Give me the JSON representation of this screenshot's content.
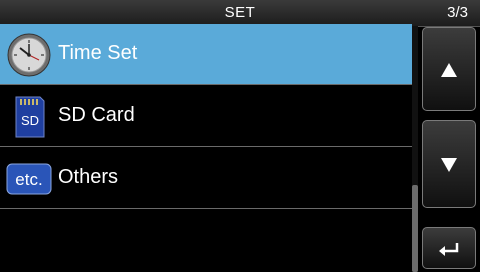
{
  "header": {
    "title": "SET",
    "page": "3/3"
  },
  "menu": {
    "items": [
      {
        "label": "Time Set",
        "icon": "clock-icon",
        "selected": true
      },
      {
        "label": "SD Card",
        "icon": "sd-card-icon",
        "icon_text": "SD",
        "selected": false
      },
      {
        "label": "Others",
        "icon": "etc-icon",
        "icon_text": "etc.",
        "selected": false
      }
    ]
  },
  "controls": {
    "up": "scroll-up-icon",
    "down": "scroll-down-icon",
    "back": "return-icon"
  },
  "colors": {
    "selected_row": "#5aaad9",
    "background": "#000000"
  }
}
